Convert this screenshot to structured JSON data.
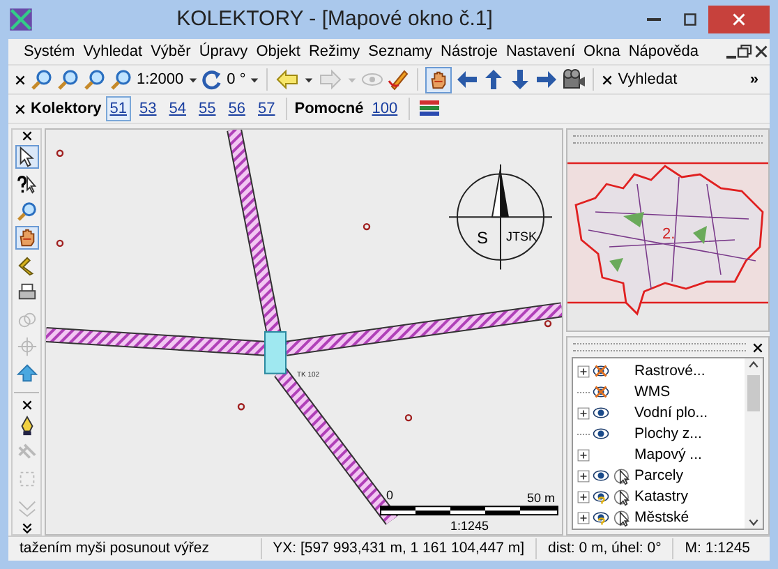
{
  "window": {
    "title": "KOLEKTORY - [Mapové okno č.1]"
  },
  "menu": [
    "Systém",
    "Vyhledat",
    "Výběr",
    "Úpravy",
    "Objekt",
    "Režimy",
    "Seznamy",
    "Nástroje",
    "Nastavení",
    "Okna",
    "Nápověda"
  ],
  "toolbar": {
    "scale": "1:2000",
    "rotation": "0 °",
    "search_label": "Vyhledat",
    "more": "»"
  },
  "layer_bar": {
    "group": "Kolektory",
    "sheets": [
      {
        "label": "51",
        "selected": true
      },
      {
        "label": "53",
        "selected": false
      },
      {
        "label": "54",
        "selected": false
      },
      {
        "label": "55",
        "selected": false
      },
      {
        "label": "56",
        "selected": false
      },
      {
        "label": "57",
        "selected": false
      }
    ],
    "aux_group": "Pomocné",
    "aux_sheets": [
      {
        "label": "100",
        "selected": false
      }
    ]
  },
  "tools": [
    {
      "kind": "pointer",
      "selected": true,
      "disabled": false
    },
    {
      "kind": "query",
      "selected": false,
      "disabled": false
    },
    {
      "kind": "zoom",
      "selected": false,
      "disabled": false
    },
    {
      "kind": "pan",
      "selected": true,
      "disabled": false
    },
    {
      "kind": "measure",
      "selected": false,
      "disabled": false
    },
    {
      "kind": "print",
      "selected": false,
      "disabled": false
    },
    {
      "kind": "circles",
      "selected": false,
      "disabled": true
    },
    {
      "kind": "target",
      "selected": false,
      "disabled": true
    },
    {
      "kind": "up",
      "selected": false,
      "disabled": false
    }
  ],
  "edit_tools": [
    {
      "kind": "pen",
      "disabled": false
    },
    {
      "kind": "pattern",
      "disabled": true
    },
    {
      "kind": "frame",
      "disabled": true
    },
    {
      "kind": "vertex",
      "disabled": true
    }
  ],
  "map": {
    "label": "TK 102",
    "compass": {
      "letter": "S",
      "system": "JTSK"
    },
    "scale_bar": {
      "start": "0",
      "end": "50 m",
      "scale": "1:1245"
    }
  },
  "overview": {
    "label": "2."
  },
  "layers": [
    {
      "name": "Rastrové...",
      "expandable": true,
      "kind": "muted",
      "pointer": false
    },
    {
      "name": "WMS",
      "expandable": false,
      "kind": "muted",
      "pointer": false
    },
    {
      "name": "Vodní plo...",
      "expandable": true,
      "kind": "visible",
      "pointer": false
    },
    {
      "name": "Plochy z...",
      "expandable": false,
      "kind": "visible",
      "pointer": false
    },
    {
      "name": "Mapový ...",
      "expandable": true,
      "kind": "plain",
      "pointer": false
    },
    {
      "name": "Parcely",
      "expandable": true,
      "kind": "visible",
      "pointer": true
    },
    {
      "name": "Katastry",
      "expandable": true,
      "kind": "uncertain",
      "pointer": true
    },
    {
      "name": "Městské",
      "expandable": true,
      "kind": "uncertain",
      "pointer": true
    }
  ],
  "status_bar": {
    "hint": "tažením myši posunout výřez",
    "coords": "YX: [597 993,431 m, 1 161 104,447 m]",
    "distance": "dist: 0 m, úhel: 0°",
    "scale": "M: 1:1245"
  }
}
